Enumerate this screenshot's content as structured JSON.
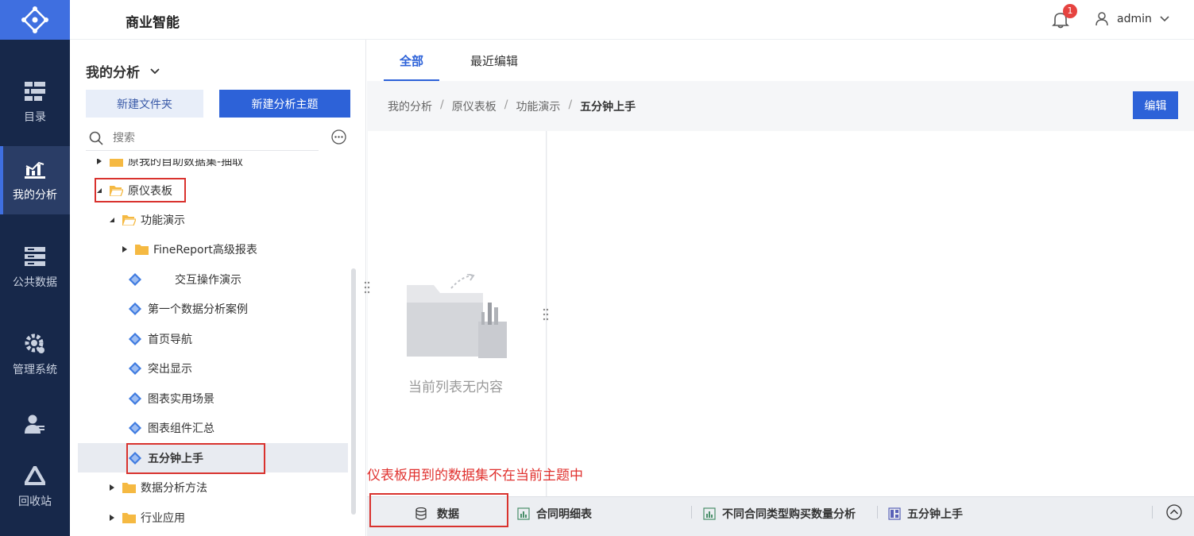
{
  "nav": {
    "items": [
      {
        "label": "目录",
        "icon": "catalog-icon"
      },
      {
        "label": "我的分析",
        "icon": "analysis-chart-icon"
      },
      {
        "label": "公共数据",
        "icon": "database-icon"
      },
      {
        "label": "管理系统",
        "icon": "gear-icon"
      },
      {
        "label": "回收站",
        "icon": "recycle-icon"
      }
    ]
  },
  "header": {
    "app_title": "商业智能",
    "notification_count": "1",
    "username": "admin"
  },
  "panel": {
    "title": "我的分析",
    "new_folder_label": "新建文件夹",
    "new_topic_label": "新建分析主题",
    "search_placeholder": "搜索",
    "tree": [
      {
        "label": "原我的自助数据集-抽取",
        "type": "folder"
      },
      {
        "label": "原仪表板",
        "type": "folder"
      },
      {
        "label": "功能演示",
        "type": "folder"
      },
      {
        "label": "FineReport高级报表",
        "type": "folder"
      },
      {
        "label": "交互操作演示",
        "type": "topic"
      },
      {
        "label": "第一个数据分析案例",
        "type": "topic"
      },
      {
        "label": "首页导航",
        "type": "topic"
      },
      {
        "label": "突出显示",
        "type": "topic"
      },
      {
        "label": "图表实用场景",
        "type": "topic"
      },
      {
        "label": "图表组件汇总",
        "type": "topic"
      },
      {
        "label": "五分钟上手",
        "type": "topic"
      },
      {
        "label": "数据分析方法",
        "type": "folder"
      },
      {
        "label": "行业应用",
        "type": "folder"
      }
    ]
  },
  "tabs": [
    {
      "label": "全部"
    },
    {
      "label": "最近编辑"
    }
  ],
  "breadcrumb": {
    "items": [
      "我的分析",
      "原仪表板",
      "功能演示"
    ],
    "current": "五分钟上手",
    "separator": "/"
  },
  "edit_label": "编辑",
  "empty_text": "当前列表无内容",
  "warning_text": "仪表板用到的数据集不在当前主题中",
  "bottom_tabs": [
    {
      "label": "数据",
      "icon": "database-icon"
    },
    {
      "label": "合同明细表",
      "icon": "bar-chart-icon"
    },
    {
      "label": "不同合同类型购买数量分析",
      "icon": "bar-chart-icon"
    },
    {
      "label": "五分钟上手",
      "icon": "dashboard-icon"
    }
  ],
  "colors": {
    "accent": "#2d62d8",
    "nav_bg": "#17284a",
    "warning": "#e0322f",
    "folder": "#f5b942",
    "topic": "#3f7be0"
  }
}
